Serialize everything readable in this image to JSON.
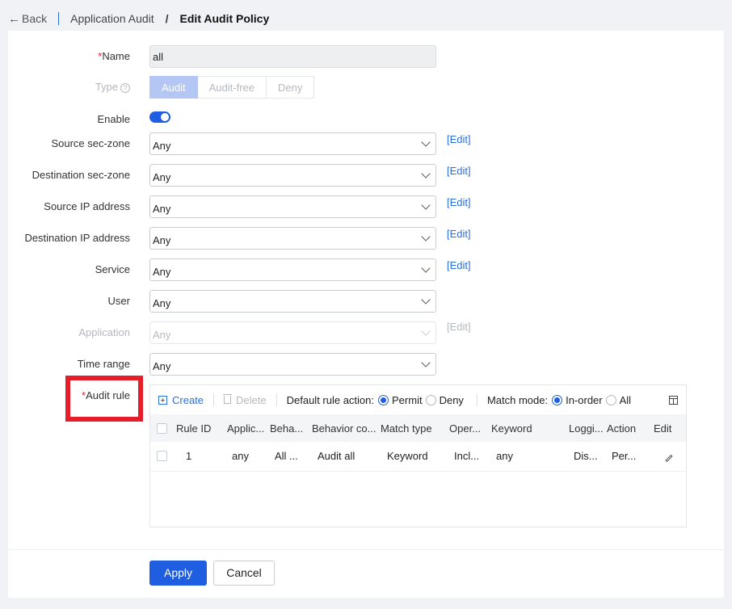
{
  "breadcrumb": {
    "back_label": "Back",
    "parent": "Application Audit",
    "separator": "/",
    "current": "Edit Audit Policy"
  },
  "form": {
    "name": {
      "label": "Name",
      "value": "all"
    },
    "type": {
      "label": "Type",
      "options": [
        "Audit",
        "Audit-free",
        "Deny"
      ],
      "selected": "Audit"
    },
    "enable": {
      "label": "Enable",
      "on": true
    },
    "source_zone": {
      "label": "Source sec-zone",
      "value": "Any",
      "link": "[Edit]"
    },
    "dest_zone": {
      "label": "Destination sec-zone",
      "value": "Any",
      "link": "[Edit]"
    },
    "source_ip": {
      "label": "Source IP address",
      "value": "Any",
      "link": "[Edit]"
    },
    "dest_ip": {
      "label": "Destination IP address",
      "value": "Any",
      "link": "[Edit]"
    },
    "service": {
      "label": "Service",
      "value": "Any",
      "link": "[Edit]"
    },
    "user": {
      "label": "User",
      "value": "Any"
    },
    "application": {
      "label": "Application",
      "value": "Any",
      "link": "[Edit]"
    },
    "time_range": {
      "label": "Time range",
      "value": "Any"
    },
    "audit_rule_label": "Audit rule"
  },
  "rules_toolbar": {
    "create": "Create",
    "delete": "Delete",
    "default_action_label": "Default rule action:",
    "permit": "Permit",
    "deny": "Deny",
    "match_mode_label": "Match mode:",
    "in_order": "In-order",
    "all": "All"
  },
  "rules_table": {
    "columns": [
      "Rule ID",
      "Applic...",
      "Beha...",
      "Behavior co...",
      "Match type",
      "Oper...",
      "Keyword",
      "Loggi...",
      "Action",
      "Edit"
    ],
    "rows": [
      [
        "1",
        "any",
        "All ...",
        "Audit all",
        "Keyword",
        "Incl...",
        "any",
        "Dis...",
        "Per..."
      ]
    ]
  },
  "footer": {
    "apply": "Apply",
    "cancel": "Cancel"
  },
  "colors": {
    "primary": "#1f5ee0",
    "link": "#2b6fd6",
    "required": "#e0232e",
    "highlight_box": "#e61e2a"
  }
}
